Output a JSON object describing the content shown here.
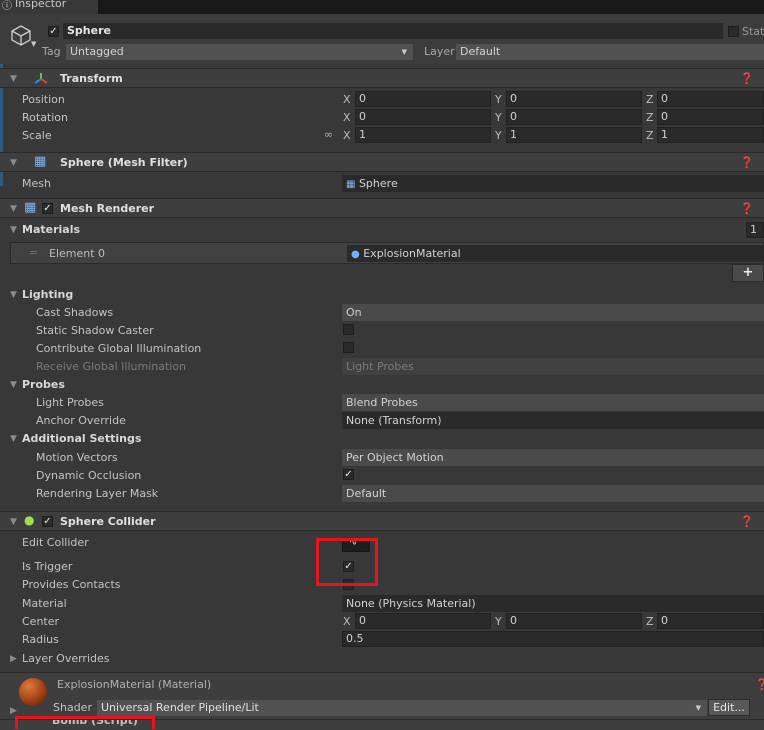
{
  "tab": {
    "title": "Inspector"
  },
  "object": {
    "name": "Sphere",
    "static_label": "Stat",
    "tag_label": "Tag",
    "tag_value": "Untagged",
    "layer_label": "Layer",
    "layer_value": "Default"
  },
  "transform": {
    "title": "Transform",
    "position_label": "Position",
    "rotation_label": "Rotation",
    "scale_label": "Scale",
    "x": "X",
    "y": "Y",
    "z": "Z",
    "position": [
      "0",
      "0",
      "0"
    ],
    "rotation": [
      "0",
      "0",
      "0"
    ],
    "scale": [
      "1",
      "1",
      "1"
    ]
  },
  "mesh_filter": {
    "title": "Sphere (Mesh Filter)",
    "mesh_label": "Mesh",
    "mesh_value": "Sphere"
  },
  "mesh_renderer": {
    "title": "Mesh Renderer",
    "materials_label": "Materials",
    "materials_count": "1",
    "element0_label": "Element 0",
    "element0_value": "ExplosionMaterial",
    "add_label": "+",
    "lighting_label": "Lighting",
    "cast_shadows_label": "Cast Shadows",
    "cast_shadows_value": "On",
    "static_shadow_label": "Static Shadow Caster",
    "contribute_gi_label": "Contribute Global Illumination",
    "receive_gi_label": "Receive Global Illumination",
    "receive_gi_value": "Light Probes",
    "probes_label": "Probes",
    "light_probes_label": "Light Probes",
    "light_probes_value": "Blend Probes",
    "anchor_label": "Anchor Override",
    "anchor_value": "None (Transform)",
    "additional_label": "Additional Settings",
    "motion_label": "Motion Vectors",
    "motion_value": "Per Object Motion",
    "dyn_occ_label": "Dynamic Occlusion",
    "layer_mask_label": "Rendering Layer Mask",
    "layer_mask_value": "Default"
  },
  "sphere_collider": {
    "title": "Sphere Collider",
    "edit_label": "Edit Collider",
    "trigger_label": "Is Trigger",
    "contacts_label": "Provides Contacts",
    "material_label": "Material",
    "material_value": "None (Physics Material)",
    "center_label": "Center",
    "center": [
      "0",
      "0",
      "0"
    ],
    "radius_label": "Radius",
    "radius_value": "0.5",
    "overrides_label": "Layer Overrides"
  },
  "material": {
    "title": "ExplosionMaterial (Material)",
    "shader_label": "Shader",
    "shader_value": "Universal Render Pipeline/Lit",
    "edit_label": "Edit..."
  },
  "next_component": {
    "title": "Bomb (Script)"
  },
  "colors": {
    "highlight": "#e8141c",
    "header_bg": "#3e3e3e",
    "panel_bg": "#383838"
  }
}
